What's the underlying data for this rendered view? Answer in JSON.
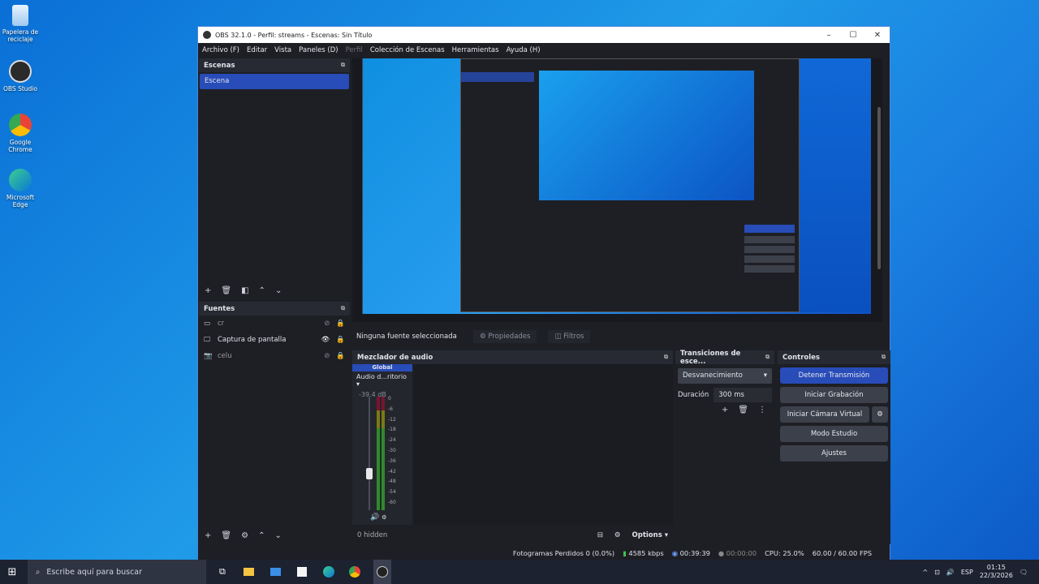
{
  "desktop": {
    "icons": [
      {
        "label": "Papelera de reciclaje",
        "icon": "recycle-bin-icon"
      },
      {
        "label": "OBS Studio",
        "icon": "obs-icon"
      },
      {
        "label": "Google Chrome",
        "icon": "chrome-icon"
      },
      {
        "label": "Microsoft Edge",
        "icon": "edge-icon"
      }
    ]
  },
  "window": {
    "title": "OBS 32.1.0 - Perfil: streams - Escenas: Sin Título"
  },
  "menu": [
    "Archivo (F)",
    "Editar",
    "Vista",
    "Paneles (D)",
    "Perfil",
    "Colección de Escenas",
    "Herramientas",
    "Ayuda (H)"
  ],
  "scenes": {
    "title": "Escenas",
    "items": [
      "Escena"
    ]
  },
  "sources": {
    "title": "Fuentes",
    "items": [
      {
        "name": "cr",
        "icon": "window-icon"
      },
      {
        "name": "Captura de pantalla",
        "icon": "monitor-icon"
      },
      {
        "name": "celu",
        "icon": "camera-icon"
      }
    ]
  },
  "context_bar": {
    "no_source": "Ninguna fuente seleccionada",
    "properties": "Propiedades",
    "filters": "Filtros"
  },
  "audio": {
    "title": "Mezclador de audio",
    "tab": "Global",
    "device": "Audio d...ritorio",
    "level": "-39.4 dB",
    "scale": [
      "0",
      "-6",
      "-12",
      "-18",
      "-24",
      "-30",
      "-36",
      "-42",
      "-48",
      "-54",
      "-60"
    ],
    "hidden": "0 hidden",
    "options": "Options"
  },
  "transitions": {
    "title": "Transiciones de esce...",
    "selected": "Desvanecimiento",
    "duration_label": "Duración",
    "duration_value": "300 ms"
  },
  "controls": {
    "title": "Controles",
    "stop_stream": "Detener Transmisión",
    "start_record": "Iniciar Grabación",
    "virtual_cam": "Iniciar Cámara Virtual",
    "studio_mode": "Modo Estudio",
    "settings": "Ajustes"
  },
  "status": {
    "dropped": "Fotogramas Perdidos 0 (0.0%)",
    "bitrate": "4585 kbps",
    "stream_time": "00:39:39",
    "rec_time": "00:00:00",
    "cpu": "CPU: 25.0%",
    "fps": "60.00 / 60.00 FPS"
  },
  "taskbar": {
    "search_placeholder": "Escribe aquí para buscar",
    "lang": "ESP",
    "time": "01:15",
    "date": "22/3/2026"
  },
  "colors": {
    "accent": "#284cb8",
    "desktop": "#1a8fe6"
  }
}
